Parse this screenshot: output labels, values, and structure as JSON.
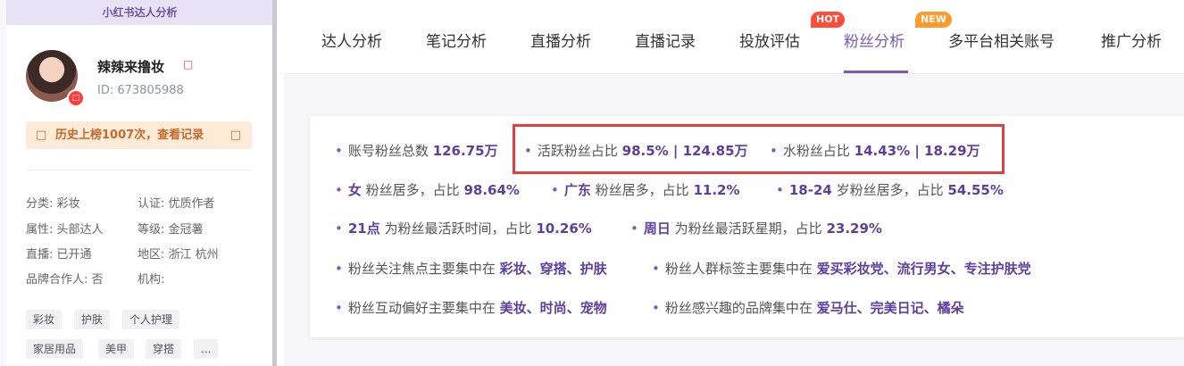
{
  "sidebar": {
    "header": "小红书达人分析",
    "profile": {
      "name": "辣辣来撸妆",
      "name_icon": "□",
      "id": "ID:  673805988",
      "avatar_badge": "□"
    },
    "history": {
      "icon": "□",
      "text": "历史上榜1007次，查看记录",
      "arrow": "□"
    },
    "attributes": [
      "分类: 彩妆",
      "认证: 优质作者",
      "属性: 头部达人",
      "等级: 金冠薯",
      "直播: 已开通",
      "地区: 浙江 杭州",
      "品牌合作人: 否",
      "机构:"
    ],
    "tags": [
      "彩妆",
      "护肤",
      "个人护理",
      "家居用品",
      "美甲",
      "穿搭",
      "..."
    ]
  },
  "tabs": {
    "items": [
      "达人分析",
      "笔记分析",
      "直播分析",
      "直播记录",
      "投放评估",
      "粉丝分析",
      "多平台相关账号",
      "推广分析"
    ],
    "active": "粉丝分析",
    "hot_badge": "HOT",
    "new_badge": "NEW"
  },
  "stats": {
    "bullet": "•",
    "row1": [
      {
        "label": "账号粉丝总数",
        "value": "126.75万"
      },
      {
        "label": "活跃粉丝占比",
        "value": "98.5% | 124.85万"
      },
      {
        "label": "水粉丝占比",
        "value": "14.43% | 18.29万"
      }
    ],
    "row2": [
      {
        "pre": "女",
        "label": "粉丝居多，占比",
        "value": "98.64%"
      },
      {
        "pre": "广东",
        "label": "粉丝居多，占比",
        "value": "11.2%"
      },
      {
        "pre": "18-24",
        "label": "岁粉丝居多，占比",
        "value": "54.55%"
      }
    ],
    "row3": [
      {
        "pre": "21点",
        "label": "为粉丝最活跃时间，占比",
        "value": "10.26%"
      },
      {
        "pre": "周日",
        "label": "为粉丝最活跃星期，占比",
        "value": "23.29%"
      }
    ],
    "row4": [
      {
        "label": "粉丝关注焦点主要集中在",
        "value": "彩妆、穿搭、护肤"
      },
      {
        "label": "粉丝人群标签主要集中在",
        "value": "爱买彩妆党、流行男女、专注护肤党"
      }
    ],
    "row5": [
      {
        "label": "粉丝互动偏好主要集中在",
        "value": "美妆、时尚、宠物"
      },
      {
        "label": "粉丝感兴趣的品牌集中在",
        "value": "爱马仕、完美日记、橘朵"
      }
    ]
  },
  "colors": {
    "accent": "#7a5bb5",
    "highlight": "#e0403f",
    "hot": "#ff4d3a",
    "new": "#ff9a2e"
  }
}
